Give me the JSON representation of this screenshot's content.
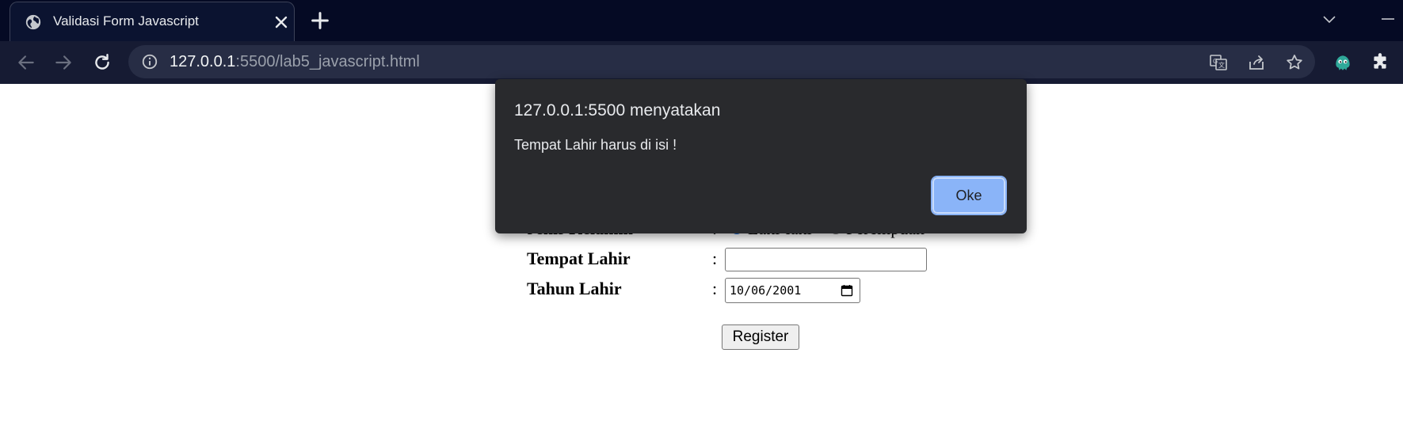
{
  "browser": {
    "tab_title": "Validasi Form Javascript",
    "url_host": "127.0.0.1",
    "url_rest": ":5500/lab5_javascript.html"
  },
  "form": {
    "gender": {
      "label": "Jenis Kelamin",
      "colon": ":",
      "options": [
        "Laki-laki",
        "Perempuan"
      ],
      "selected": "Laki-laki"
    },
    "birthplace": {
      "label": "Tempat Lahir",
      "colon": ":",
      "value": ""
    },
    "birthyear": {
      "label": "Tahun Lahir",
      "colon": ":",
      "value": "10/06/2001"
    },
    "register_label": "Register"
  },
  "dialog": {
    "title": "127.0.0.1:5500 menyatakan",
    "message": "Tempat Lahir harus di isi !",
    "ok_label": "Oke"
  },
  "colors": {
    "titlebar": "#050a24",
    "toolbar": "#161b33",
    "dialog_bg": "#292a2d",
    "ok_button": "#8ab4f8"
  }
}
